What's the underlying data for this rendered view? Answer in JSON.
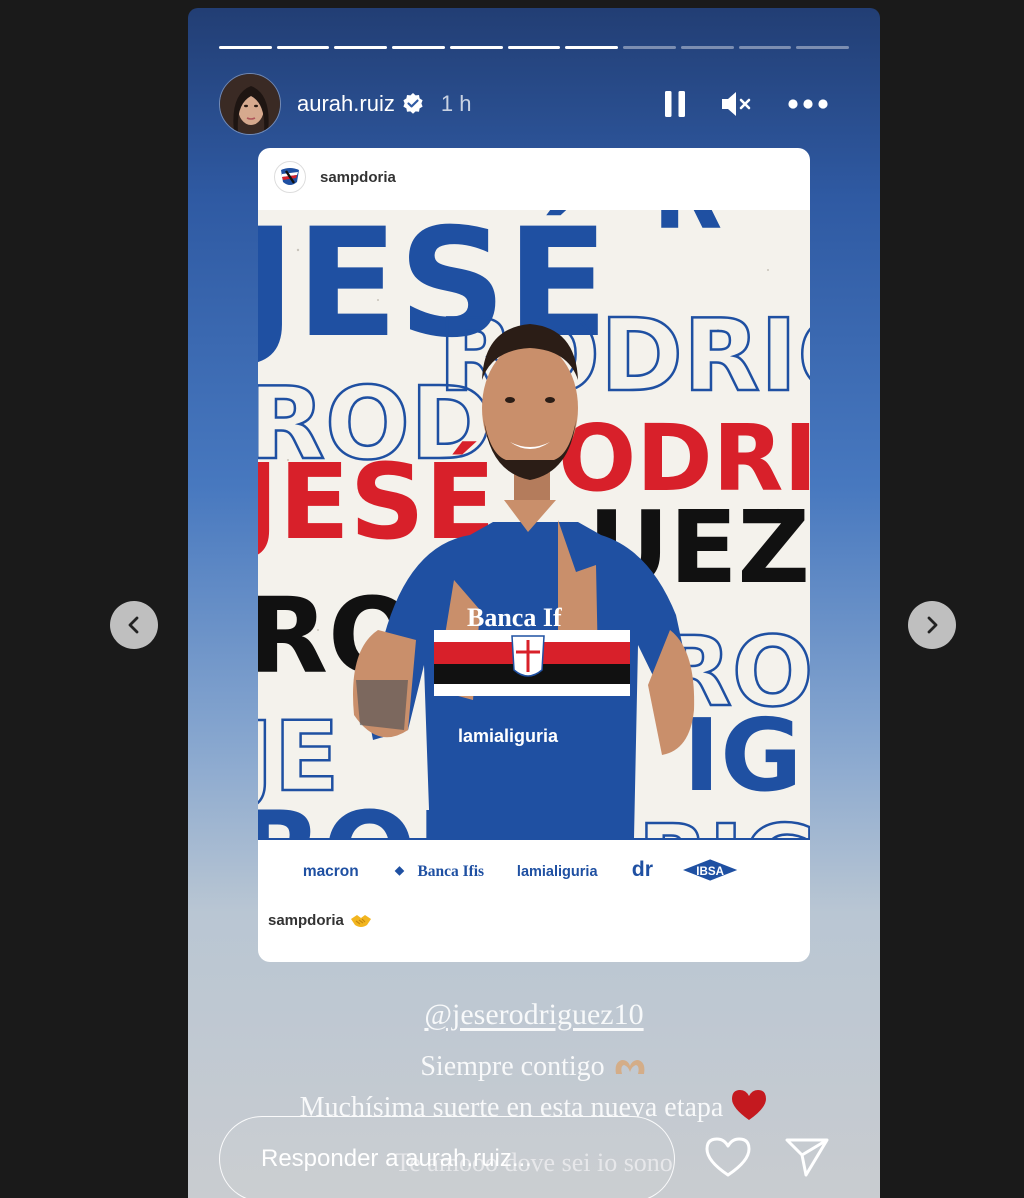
{
  "story": {
    "progress": [
      1,
      1,
      1,
      1,
      1,
      1,
      1,
      0,
      0,
      0,
      0
    ],
    "username": "aurah.ruiz",
    "time": "1 h"
  },
  "post": {
    "username": "sampdoria",
    "poster_words": {
      "name_big": "JESÉ",
      "surname_big": "RODRIGUEZ",
      "rodrigu": "RODRIGU",
      "rod": "ROD",
      "uez": "UEZ"
    },
    "sponsors": [
      "macron",
      "Banca Ifis",
      "lamialiguria",
      "dr",
      "IBSA"
    ],
    "shirt": {
      "sponsor_chest": "Banca If",
      "sponsor_lower": "lamialiguria"
    },
    "caption": "sampdoria"
  },
  "story_text": {
    "mention": "@jeserodriguez10",
    "line1": "Siempre contigo",
    "line2": "Muchísima suerte en esta nueva etapa",
    "line3": "Te amooo dove sei io sono"
  },
  "reply": {
    "placeholder": "Responder a aurah.ruiz..."
  },
  "colors": {
    "page_bg": "#1a1a1a",
    "sampdoria_blue": "#1f50a2",
    "sampdoria_red": "#d8202a",
    "heart_red": "#c4191f"
  },
  "icons": [
    "verified-icon",
    "pause-icon",
    "muted-icon",
    "more-icon",
    "heart-icon",
    "send-icon",
    "chevron-left-icon",
    "chevron-right-icon"
  ]
}
